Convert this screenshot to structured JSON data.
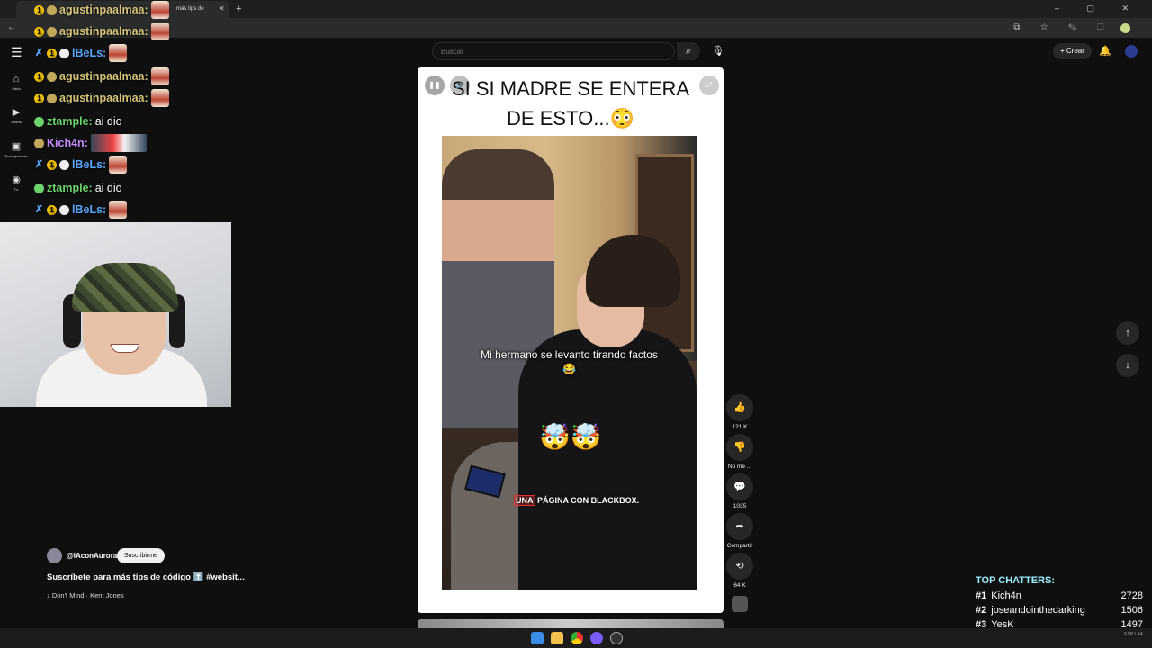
{
  "browser": {
    "tab_title": "más tips de",
    "new_tab": "+",
    "window_controls": "–  ▢  ✕"
  },
  "youtube": {
    "search_placeholder": "Buscar",
    "create_label": "Crear",
    "nav": [
      {
        "icon": "home-icon",
        "label": "Inicio"
      },
      {
        "icon": "shorts-icon",
        "label": "Shorts"
      },
      {
        "icon": "subscriptions-icon",
        "label": "Suscripciones"
      },
      {
        "icon": "you-icon",
        "label": "Tú"
      }
    ]
  },
  "chat": [
    {
      "user": "agustinpaalmaa",
      "color": "#d4c47a",
      "message": "",
      "badges": [
        "gold",
        "silver"
      ],
      "emote": true
    },
    {
      "user": "agustinpaalmaa",
      "color": "#d4c47a",
      "message": "",
      "badges": [
        "gold",
        "silver"
      ],
      "emote": true
    },
    {
      "user": "lBeLs",
      "color": "#5aa8ff",
      "message": "",
      "badges": [
        "sword",
        "gold",
        "white"
      ],
      "emote": true
    },
    {
      "user": "agustinpaalmaa",
      "color": "#d4c47a",
      "message": "",
      "badges": [
        "gold",
        "silver"
      ],
      "emote": true
    },
    {
      "user": "agustinpaalmaa",
      "color": "#d4c47a",
      "message": "",
      "badges": [
        "gold",
        "silver"
      ],
      "emote": true
    },
    {
      "user": "ztample",
      "color": "#6bd46b",
      "message": "ai dio",
      "badges": [
        "green"
      ],
      "emote": false
    },
    {
      "user": "Kich4n",
      "color": "#c58cff",
      "message": "",
      "badges": [
        "silver"
      ],
      "emote_wide": true
    },
    {
      "user": "lBeLs",
      "color": "#5aa8ff",
      "message": "",
      "badges": [
        "sword",
        "gold",
        "white"
      ],
      "emote": true
    },
    {
      "user": "ztample",
      "color": "#6bd46b",
      "message": "ai dio",
      "badges": [
        "green"
      ],
      "emote": false
    },
    {
      "user": "lBeLs",
      "color": "#5aa8ff",
      "message": "",
      "badges": [
        "sword",
        "gold",
        "white"
      ],
      "emote": true
    }
  ],
  "short": {
    "title_line1": "SI SI MADRE SE ENTERA",
    "title_line2": "DE ESTO...😳",
    "caption": "Mi hermano se levanto tirando factos😂",
    "emojis": "🤯🤯",
    "brand_prefix": "UNA",
    "brand_rest": " PÁGINA CON BLACKBOX."
  },
  "actions": [
    {
      "name": "like",
      "icon": "👍",
      "label": "121 K"
    },
    {
      "name": "dislike",
      "icon": "👎",
      "label": "No me ..."
    },
    {
      "name": "comments",
      "icon": "💬",
      "label": "1035"
    },
    {
      "name": "share",
      "icon": "➦",
      "label": "Compartir"
    },
    {
      "name": "remix",
      "icon": "⟲",
      "label": "64 K"
    }
  ],
  "channel": {
    "name": "@IAconAurora",
    "subscribe_label": "Suscribirme",
    "description": "Suscríbete para más tips de código ⬆️  #websit...",
    "music": "♪ Don't Mind · Kent Jones"
  },
  "top_chatters": {
    "title": "TOP CHATTERS:",
    "rows": [
      {
        "rank": "#1",
        "name": "Kich4n",
        "count": "2728"
      },
      {
        "rank": "#2",
        "name": "joseandointhedarking",
        "count": "1506"
      },
      {
        "rank": "#3",
        "name": "YesK",
        "count": "1497"
      }
    ]
  },
  "tray": {
    "lang": "ESP LAA"
  }
}
